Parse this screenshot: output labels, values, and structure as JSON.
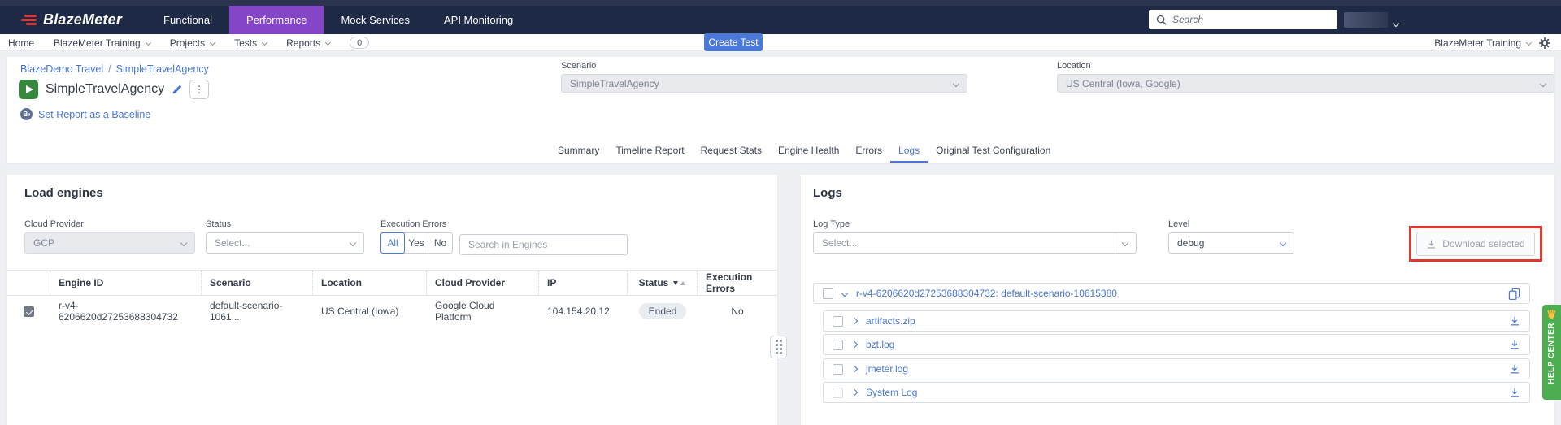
{
  "topnav": {
    "brand": "BlazeMeter",
    "items": [
      "Functional",
      "Performance",
      "Mock Services",
      "API Monitoring"
    ],
    "active_item": "Performance",
    "search_placeholder": "Search"
  },
  "subnav": {
    "items": [
      "Home",
      "BlazeMeter Training",
      "Projects",
      "Tests",
      "Reports"
    ],
    "reports_badge": "0",
    "create_test_label": "Create Test",
    "workspace_label": "BlazeMeter Training"
  },
  "header": {
    "breadcrumb": {
      "parent": "BlazeDemo Travel",
      "separator": "/",
      "current": "SimpleTravelAgency"
    },
    "title": "SimpleTravelAgency",
    "baseline_link": "Set Report as a Baseline",
    "scenario": {
      "label": "Scenario",
      "value": "SimpleTravelAgency"
    },
    "location": {
      "label": "Location",
      "value": "US Central (Iowa, Google)"
    },
    "tabs": [
      "Summary",
      "Timeline Report",
      "Request Stats",
      "Engine Health",
      "Errors",
      "Logs",
      "Original Test Configuration"
    ],
    "active_tab": "Logs"
  },
  "load_engines": {
    "title": "Load engines",
    "filters": {
      "cloud_provider": {
        "label": "Cloud Provider",
        "value": "GCP"
      },
      "status": {
        "label": "Status",
        "placeholder": "Select..."
      },
      "execution_errors": {
        "label": "Execution Errors",
        "options": [
          "All",
          "Yes",
          "No"
        ],
        "selected": "All"
      },
      "search_placeholder": "Search in Engines"
    },
    "table": {
      "columns": [
        "Engine ID",
        "Scenario",
        "Location",
        "Cloud Provider",
        "IP",
        "Status",
        "Execution Errors"
      ],
      "rows": [
        {
          "checked": true,
          "engine_id": "r-v4-6206620d27253688304732",
          "scenario": "default-scenario-1061...",
          "location": "US Central (Iowa)",
          "cloud_provider": "Google Cloud Platform",
          "ip": "104.154.20.12",
          "status": "Ended",
          "execution_errors": "No"
        }
      ]
    }
  },
  "logs": {
    "title": "Logs",
    "filters": {
      "log_type": {
        "label": "Log Type",
        "placeholder": "Select..."
      },
      "level": {
        "label": "Level",
        "value": "debug"
      }
    },
    "download_selected_label": "Download selected",
    "group_header": "r-v4-6206620d27253688304732: default-scenario-10615380",
    "files": [
      "artifacts.zip",
      "bzt.log",
      "jmeter.log",
      "System Log"
    ]
  },
  "help_center": {
    "label": "HELP CENTER"
  },
  "colors": {
    "accent_blue": "#4a77d4",
    "nav_navy": "#1e2946",
    "active_purple": "#8445c9",
    "play_green": "#37883f",
    "help_green": "#4cae50",
    "annotation_red": "#e03a30",
    "status_pill_bg": "#e9ecf1"
  }
}
